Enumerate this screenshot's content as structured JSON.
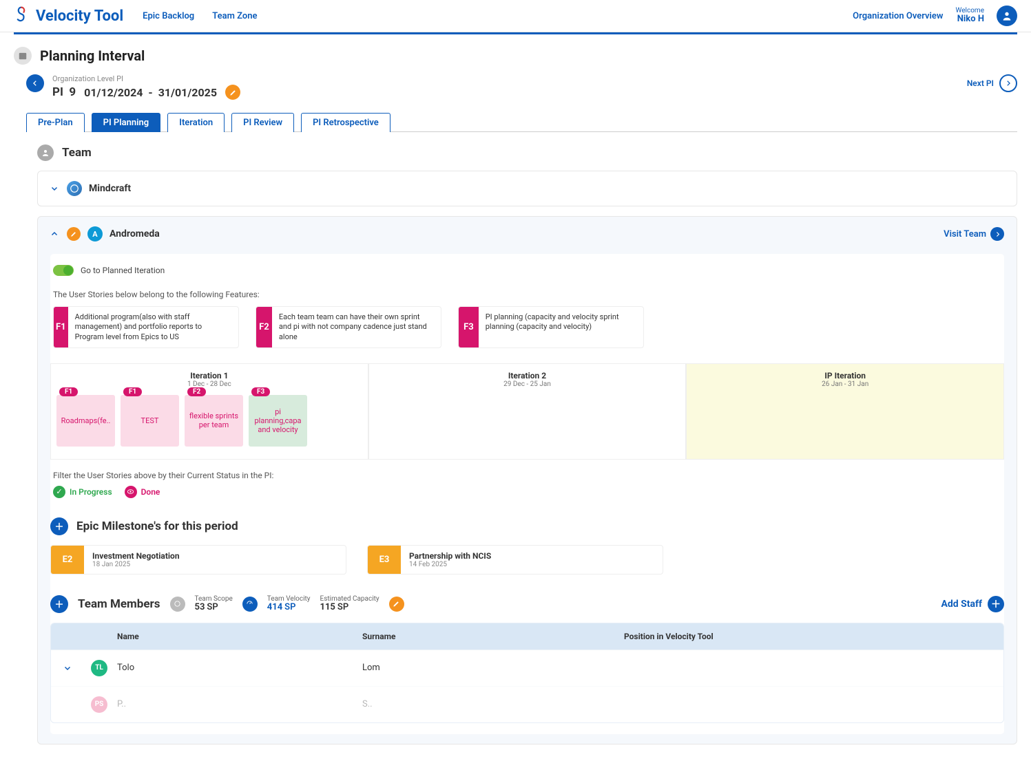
{
  "app": {
    "name": "Velocity Tool"
  },
  "nav": {
    "epic_backlog": "Epic Backlog",
    "team_zone": "Team Zone",
    "org_overview": "Organization Overview",
    "welcome_label": "Welcome",
    "user_name": "Niko H"
  },
  "page": {
    "title": "Planning Interval",
    "level_label": "Organization Level PI",
    "pi_label": "PI",
    "pi_number": "9",
    "date_start": "01/12/2024",
    "date_sep": "-",
    "date_end": "31/01/2025",
    "next_pi": "Next PI"
  },
  "tabs": {
    "preplan": "Pre-Plan",
    "planning": "PI Planning",
    "iteration": "Iteration",
    "review": "PI Review",
    "retro": "PI Retrospective"
  },
  "team_section": {
    "title": "Team"
  },
  "team_mindcraft": {
    "name": "Mindcraft"
  },
  "team_andromeda": {
    "name": "Andromeda",
    "visit": "Visit Team",
    "toggle_label": "Go to Planned Iteration",
    "features_note": "The User Stories below belong to the following Features:",
    "features": {
      "f1": {
        "code": "F1",
        "text": "Additional program(also with staff management) and portfolio reports to Program level from Epics to US"
      },
      "f2": {
        "code": "F2",
        "text": "Each team team can have their own sprint and pi with not company cadence just stand alone"
      },
      "f3": {
        "code": "F3",
        "text": "PI planning (capacity and velocity sprint planning (capacity and velocity)"
      }
    },
    "iterations": {
      "it1": {
        "title": "Iteration 1",
        "dates": "1 Dec - 28 Dec"
      },
      "it2": {
        "title": "Iteration 2",
        "dates": "29 Dec - 25 Jan"
      },
      "ip": {
        "title": "IP Iteration",
        "dates": "26 Jan - 31 Jan"
      }
    },
    "stories": {
      "s1": {
        "tag": "F1",
        "text": "Roadmaps(fe.."
      },
      "s2": {
        "tag": "F1",
        "text": "TEST"
      },
      "s3": {
        "tag": "F2",
        "text": "flexible sprints per team"
      },
      "s4": {
        "tag": "F3",
        "text": "pi planning,capa and velocity"
      }
    },
    "filter_note": "Filter the User Stories above by their Current Status in the PI:",
    "status_in_progress": "In Progress",
    "status_done": "Done"
  },
  "milestones": {
    "title": "Epic Milestone's for this period",
    "m1": {
      "code": "E2",
      "title": "Investment Negotiation",
      "date": "18 Jan 2025"
    },
    "m2": {
      "code": "E3",
      "title": "Partnership with NCIS",
      "date": "14 Feb 2025"
    }
  },
  "members": {
    "title": "Team Members",
    "scope_label": "Team Scope",
    "scope_value": "53",
    "velocity_label": "Team Velocity",
    "velocity_value": "414",
    "capacity_label": "Estimated Capacity",
    "capacity_value": "115",
    "unit": "SP",
    "add_staff": "Add Staff",
    "col_name": "Name",
    "col_surname": "Surname",
    "col_position": "Position in Velocity Tool",
    "rows": {
      "r1": {
        "av": "TL",
        "name": "Tolo",
        "surname": "Lom"
      },
      "r2": {
        "av": "PS",
        "name": "P..",
        "surname": "S.."
      }
    }
  }
}
